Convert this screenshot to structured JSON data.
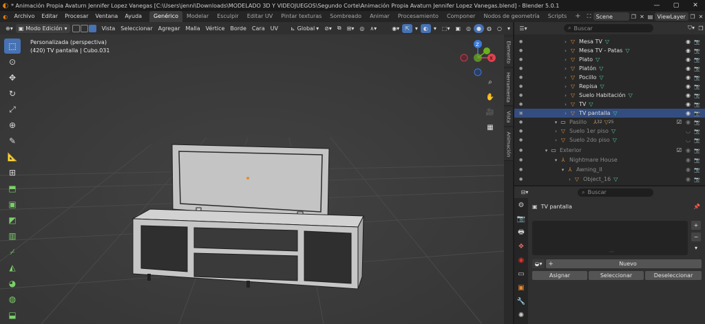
{
  "titlebar": {
    "title": "* Animación Propia Avaturn Jennifer Lopez Vanegas [C:\\Users\\jenni\\Downloads\\MODELADO 3D Y VIDEOJUEGOS\\Segundo Corte\\Animación Propia Avaturn Jennifer Lopez Vanegas.blend] - Blender 5.0.1",
    "minimize": "—",
    "maximize": "▢",
    "close": "✕"
  },
  "menu": [
    "Archivo",
    "Editar",
    "Procesar",
    "Ventana",
    "Ayuda"
  ],
  "workspaces": [
    "Genérico",
    "Modelar",
    "Esculpir",
    "Editar UV",
    "Pintar texturas",
    "Sombreado",
    "Animar",
    "Procesamiento",
    "Componer",
    "Nodos de geometría",
    "Scripts"
  ],
  "active_workspace": "Genérico",
  "add_workspace": "+",
  "scene": "Scene",
  "view_layer": "ViewLayer",
  "viewport_header": {
    "mode": "Modo Edición",
    "menus": [
      "Vista",
      "Seleccionar",
      "Agregar",
      "Malla",
      "Vértice",
      "Borde",
      "Cara",
      "UV"
    ],
    "orientation": "Global"
  },
  "viewport": {
    "view_name": "Personalizada (perspectiva)",
    "object_info": "(420) TV pantalla | Cubo.031"
  },
  "gizmo": {
    "z": "Z",
    "x": "X",
    "y": "Y"
  },
  "side_tabs": [
    "Elemento",
    "Herramienta",
    "Vista",
    "Animación"
  ],
  "outliner": {
    "search_placeholder": "Buscar",
    "rows": [
      {
        "label": "Mesa TV",
        "kind": "object",
        "selected": false,
        "dim": false
      },
      {
        "label": "Mesa TV - Patas",
        "kind": "object",
        "selected": false,
        "dim": false
      },
      {
        "label": "Plato",
        "kind": "object",
        "selected": false,
        "dim": false
      },
      {
        "label": "Platón",
        "kind": "object",
        "selected": false,
        "dim": false
      },
      {
        "label": "Pocillo",
        "kind": "object",
        "selected": false,
        "dim": false
      },
      {
        "label": "Repisa",
        "kind": "object",
        "selected": false,
        "dim": false
      },
      {
        "label": "Suelo Habitación",
        "kind": "object",
        "selected": false,
        "dim": false
      },
      {
        "label": "TV",
        "kind": "object",
        "selected": false,
        "dim": false
      },
      {
        "label": "TV pantalla",
        "kind": "object",
        "selected": true,
        "dim": false
      },
      {
        "label": "Pasillo",
        "kind": "collection",
        "selected": false,
        "dim": true
      },
      {
        "label": "Suelo 1er piso",
        "kind": "object",
        "selected": false,
        "dim": true
      },
      {
        "label": "Suelo 2do piso",
        "kind": "object",
        "selected": false,
        "dim": true
      },
      {
        "label": "Exterior",
        "kind": "collection",
        "selected": false,
        "dim": true
      },
      {
        "label": "Nightmare House",
        "kind": "armature",
        "selected": false,
        "dim": true
      },
      {
        "label": "Awning_II",
        "kind": "armature",
        "selected": false,
        "dim": true
      },
      {
        "label": "Object_16",
        "kind": "object",
        "selected": false,
        "dim": true
      }
    ],
    "pasillo_counts": {
      "a": "32",
      "b": "25"
    }
  },
  "properties": {
    "search_placeholder": "Buscar",
    "material_object": "TV pantalla",
    "new_button": "Nuevo",
    "add_slot": "+",
    "remove_slot": "−",
    "assign": "Asignar",
    "select": "Seleccionar",
    "deselect": "Deseleccionar"
  },
  "colors": {
    "accent": "#4772b3",
    "selection_row": "#334d80",
    "object_orange": "#e0913a",
    "mesh_green": "#4fd19b",
    "axis_x": "#e0404f",
    "axis_y": "#6bb021",
    "axis_z": "#3d7ad9"
  }
}
